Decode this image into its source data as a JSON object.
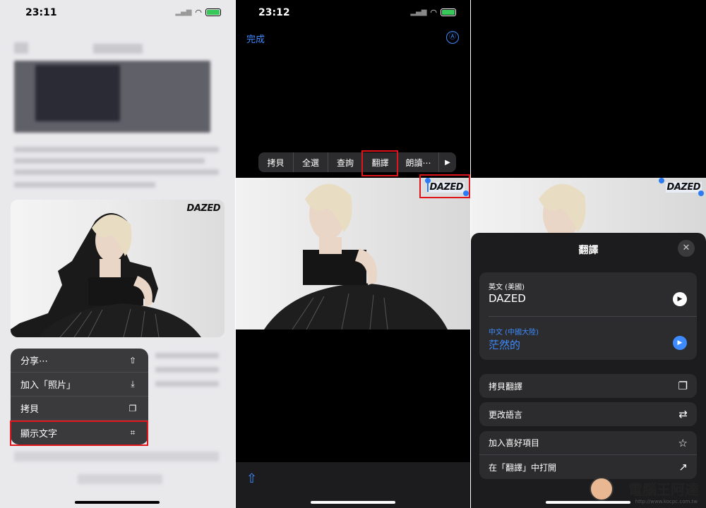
{
  "panel1": {
    "status": {
      "time": "23:11"
    },
    "photo": {
      "logo": "DAZED"
    },
    "menu": [
      {
        "label": "分享⋯",
        "icon": "share-icon",
        "glyph": "⇧"
      },
      {
        "label": "加入「照片」",
        "icon": "add-to-photos-icon",
        "glyph": "⤓"
      },
      {
        "label": "拷貝",
        "icon": "copy-icon",
        "glyph": "❐"
      },
      {
        "label": "顯示文字",
        "icon": "live-text-icon",
        "glyph": "⌗"
      }
    ]
  },
  "panel2": {
    "status": {
      "time": "23:12"
    },
    "nav": {
      "done": "完成",
      "markup_glyph": "Ⓐ"
    },
    "edit_menu": [
      {
        "label": "拷貝"
      },
      {
        "label": "全選"
      },
      {
        "label": "查詢"
      },
      {
        "label": "翻譯"
      },
      {
        "label": "朗讀⋯"
      },
      {
        "label": "▶"
      }
    ],
    "selected_text": "DAZED",
    "share_glyph": "⇧"
  },
  "panel3": {
    "photo_logo": "DAZED",
    "sheet": {
      "title": "翻譯",
      "close_glyph": "✕",
      "source": {
        "lang": "英文 (美國)",
        "text": "DAZED"
      },
      "target": {
        "lang": "中文 (中國大陸)",
        "text": "茫然的"
      },
      "play_glyph": "▶",
      "actions": [
        {
          "label": "拷貝翻譯",
          "icon": "copy-translation-icon",
          "glyph": "❐"
        },
        {
          "label": "更改語言",
          "icon": "change-language-icon",
          "glyph": "⇄"
        },
        {
          "label": "加入喜好項目",
          "icon": "star-icon",
          "glyph": "☆"
        },
        {
          "label": "在「翻譯」中打開",
          "icon": "open-external-icon",
          "glyph": "↗"
        }
      ]
    }
  },
  "watermark": {
    "text": "電腦王阿達",
    "url": "http://www.kocpc.com.tw"
  },
  "colors": {
    "accent": "#3d8bff",
    "highlight": "#e0141b",
    "sheet": "#1c1c1e"
  }
}
